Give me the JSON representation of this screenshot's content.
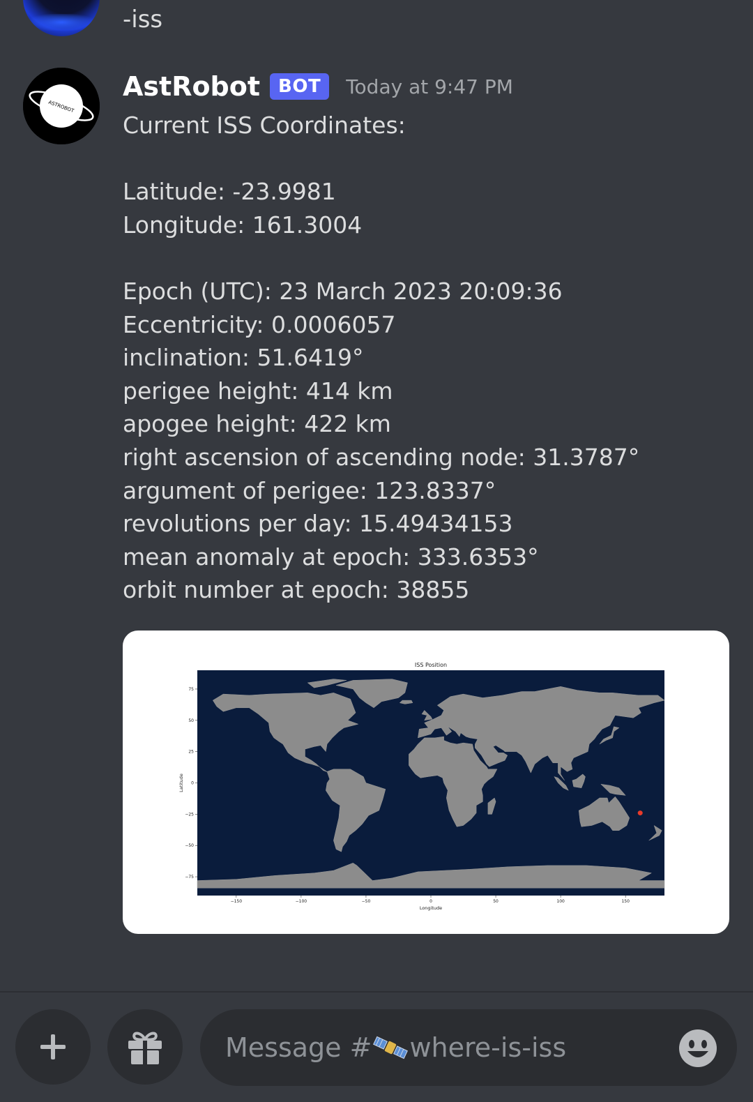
{
  "previous_message": {
    "text": "-iss"
  },
  "bot_message": {
    "author": "AstRobot",
    "badge": "BOT",
    "timestamp": "Today at 9:47 PM",
    "lines": [
      "Current ISS Coordinates:",
      "",
      "Latitude: -23.9981",
      "Longitude: 161.3004",
      "",
      "Epoch (UTC): 23 March 2023 20:09:36",
      "Eccentricity: 0.0006057",
      "inclination: 51.6419°",
      "perigee height: 414 km",
      "apogee height: 422 km",
      "right ascension of ascending node: 31.3787°",
      "argument of perigee: 123.8337°",
      "revolutions per day: 15.49434153",
      "mean anomaly at epoch: 333.6353°",
      "orbit number at epoch: 38855"
    ],
    "avatar_label": "ASTROBOT"
  },
  "chart_data": {
    "type": "scatter",
    "title": "ISS Position",
    "xlabel": "Longitude",
    "ylabel": "Latitude",
    "xlim": [
      -180,
      180
    ],
    "ylim": [
      -90,
      90
    ],
    "x_ticks": [
      -150,
      -100,
      -50,
      0,
      50,
      100,
      150
    ],
    "x_tick_labels": [
      "−150",
      "−100",
      "−50",
      "0",
      "50",
      "100",
      "150"
    ],
    "y_ticks": [
      75,
      50,
      25,
      0,
      -25,
      -50,
      -75
    ],
    "y_tick_labels": [
      "75",
      "50",
      "25",
      "0",
      "−25",
      "−50",
      "−75"
    ],
    "points": [
      {
        "x": 161.3004,
        "y": -23.9981
      }
    ],
    "colors": {
      "ocean": "#0a1c3c",
      "land": "#8c8c8c",
      "point": "#e83b2a"
    }
  },
  "composer": {
    "placeholder_prefix": "Message #",
    "channel_name": "where-is-iss"
  },
  "icons": {
    "add": "plus-icon",
    "gift": "gift-icon",
    "emoji": "emoji-icon",
    "channel": "satellite-icon"
  },
  "colors": {
    "background": "#36393f",
    "bot_badge": "#5865f2",
    "username": "#ffffff",
    "timestamp": "#a3a6aa"
  }
}
